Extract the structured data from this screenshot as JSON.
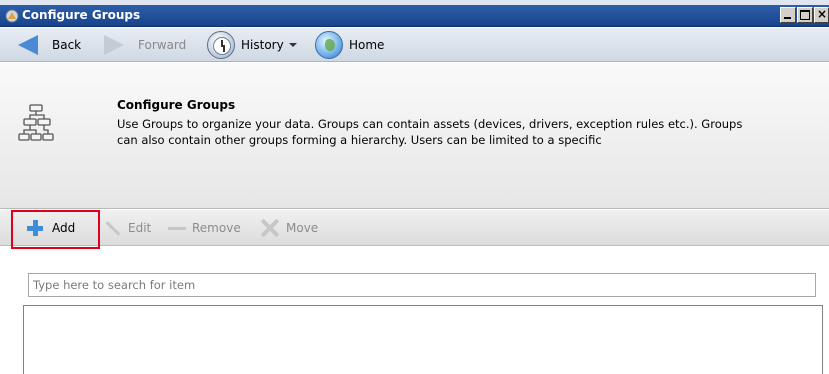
{
  "window": {
    "title": "Configure Groups"
  },
  "nav": {
    "back_label": "Back",
    "forward_label": "Forward",
    "history_label": "History",
    "home_label": "Home"
  },
  "header": {
    "title": "Configure Groups",
    "description": "Use Groups to organize your data. Groups can contain assets (devices, drivers, exception rules etc.). Groups can also contain other groups forming a hierarchy. Users can be limited to a specific"
  },
  "toolbar": {
    "add_label": "Add",
    "edit_label": "Edit",
    "remove_label": "Remove",
    "move_label": "Move"
  },
  "search": {
    "placeholder": "Type here to search for item",
    "value": ""
  },
  "colors": {
    "highlight": "#e0001b",
    "title_bar": "#1f4f97",
    "accent": "#3d8ed6"
  }
}
